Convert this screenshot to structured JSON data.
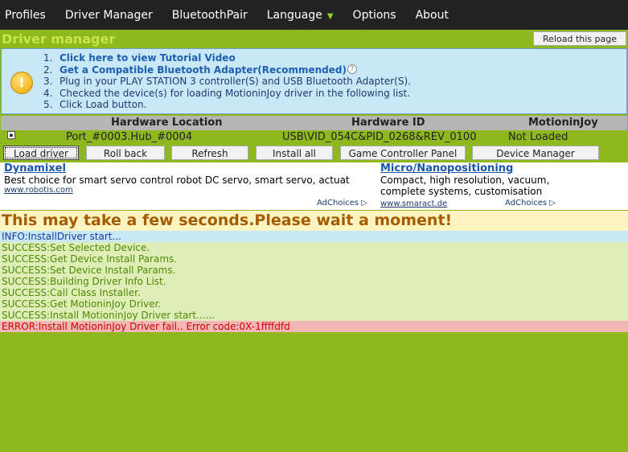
{
  "menu": {
    "items": [
      "Profiles",
      "Driver Manager",
      "BluetoothPair",
      "Language",
      "Options",
      "About"
    ]
  },
  "header": {
    "title": "Driver manager",
    "reload_label": "Reload this page"
  },
  "instructions": {
    "steps": [
      {
        "num": "1.",
        "text": "Click here to view Tutorial Video"
      },
      {
        "num": "2.",
        "text": "Get a Compatible Bluetooth Adapter(Recommended)"
      },
      {
        "num": "3.",
        "text": "Plug in your PLAY STATION 3 controller(S) and USB Bluetooth Adapter(S)."
      },
      {
        "num": "4.",
        "text": "Checked the device(s) for loading MotioninJoy driver in the following list."
      },
      {
        "num": "5.",
        "text": "Click Load button."
      }
    ],
    "help_glyph": "?",
    "warn_glyph": "!"
  },
  "table": {
    "headers": [
      "Hardware Location",
      "Hardware ID",
      "MotioninJoy"
    ],
    "rows": [
      {
        "check": "▪",
        "location": "Port_#0003.Hub_#0004",
        "hardware_id": "USB\\VID_054C&PID_0268&REV_0100",
        "status": "Not Loaded"
      }
    ]
  },
  "buttons": {
    "load": "Load driver",
    "rollback": "Roll back",
    "refresh": "Refresh",
    "install_all": "Install all",
    "game_controller": "Game Controller Panel",
    "device_manager": "Device Manager"
  },
  "ads": [
    {
      "title": "Dynamixel",
      "body": "Best choice for smart servo control robot DC servo, smart servo, actuat",
      "url": "www.robotis.com",
      "choices": "AdChoices ▷"
    },
    {
      "title": "Micro/Nanopositioning",
      "body1": "Compact, high resolution, vacuum,",
      "body2": "complete systems, customisation",
      "url": "www.smaract.de",
      "choices": "AdChoices ▷"
    }
  ],
  "wait_message": "This may take a few seconds.Please wait a moment!",
  "log": [
    {
      "type": "info",
      "text": "INFO:InstallDriver start..."
    },
    {
      "type": "success",
      "text": "SUCCESS:Set Selected Device."
    },
    {
      "type": "success",
      "text": "SUCCESS:Get Device Install Params."
    },
    {
      "type": "success",
      "text": "SUCCESS:Set Device Install Params."
    },
    {
      "type": "success",
      "text": "SUCCESS:Building Driver Info List."
    },
    {
      "type": "success",
      "text": "SUCCESS:Call Class Installer."
    },
    {
      "type": "success",
      "text": "SUCCESS:Get MotioninJoy Driver."
    },
    {
      "type": "success",
      "text": "SUCCESS:Install MotioninJoy Driver start......"
    },
    {
      "type": "error",
      "text": "ERROR:Install MotioninJoy Driver fail.. Error code:0X-1ffffdfd"
    }
  ]
}
